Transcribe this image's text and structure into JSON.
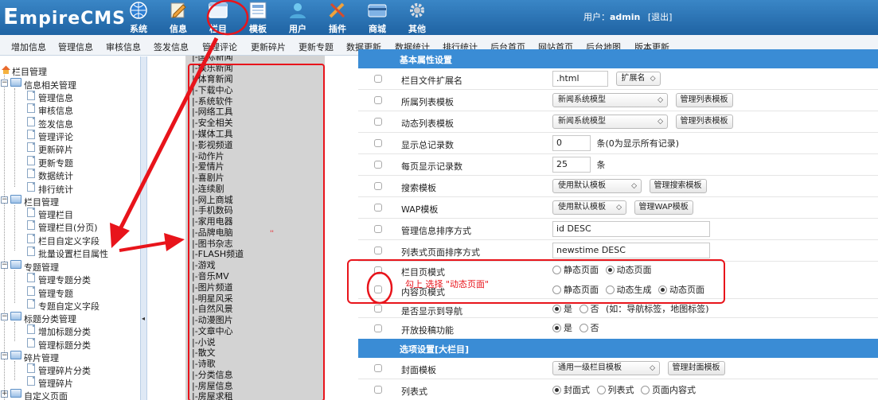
{
  "brand": {
    "logo_prefix": "E",
    "logo_rest": "mpireCMS"
  },
  "modules": [
    {
      "label": "系统",
      "icon": "globe-icon"
    },
    {
      "label": "信息",
      "icon": "pencil-icon"
    },
    {
      "label": "栏目",
      "icon": "window-icon"
    },
    {
      "label": "模板",
      "icon": "template-icon"
    },
    {
      "label": "用户",
      "icon": "user-icon"
    },
    {
      "label": "插件",
      "icon": "tools-icon"
    },
    {
      "label": "商城",
      "icon": "card-icon"
    },
    {
      "label": "其他",
      "icon": "gear-icon"
    }
  ],
  "user": {
    "prefix": "用户：",
    "name": "admin",
    "logout": "[退出]"
  },
  "nav": [
    "增加信息",
    "管理信息",
    "审核信息",
    "签发信息",
    "管理评论",
    "更新碎片",
    "更新专题",
    "数据更新",
    "数据统计",
    "排行统计",
    "后台首页",
    "网站首页",
    "后台地图",
    "版本更新"
  ],
  "tree": {
    "root": "栏目管理",
    "groups": [
      {
        "label": "信息相关管理",
        "items": [
          "管理信息",
          "审核信息",
          "签发信息",
          "管理评论",
          "更新碎片",
          "更新专题",
          "数据统计",
          "排行统计"
        ]
      },
      {
        "label": "栏目管理",
        "items": [
          "管理栏目",
          "管理栏目(分页)",
          "栏目自定义字段",
          "批量设置栏目属性"
        ]
      },
      {
        "label": "专题管理",
        "items": [
          "管理专题分类",
          "管理专题",
          "专题自定义字段"
        ]
      },
      {
        "label": "标题分类管理",
        "items": [
          "增加标题分类",
          "管理标题分类"
        ]
      },
      {
        "label": "碎片管理",
        "items": [
          "管理碎片分类",
          "管理碎片"
        ]
      },
      {
        "label": "自定义页面",
        "items": []
      }
    ]
  },
  "channels": [
    "|-国际新闻",
    "|-娱乐新闻",
    "|-体育新闻",
    "|-下载中心",
    "|-系统软件",
    "|-网络工具",
    "|-安全相关",
    "|-媒体工具",
    "|-影视频道",
    "|-动作片",
    "|-爱情片",
    "|-喜剧片",
    "|-连续剧",
    "|-网上商城",
    "|-手机数码",
    "|-家用电器",
    "|-品牌电脑",
    "|-图书杂志",
    "|-FLASH频道",
    "|-游戏",
    "|-音乐MV",
    "|-图片频道",
    "|-明星风采",
    "|-自然风景",
    "|-动漫图片",
    "|-文章中心",
    "|-小说",
    "|-散文",
    "|-诗歌",
    "|-分类信息",
    "|-房屋信息",
    "|-房屋求租"
  ],
  "form": {
    "section1": "基本属性设置",
    "section2": "选项设置[大栏目]",
    "rows": {
      "ext": {
        "label": "栏目文件扩展名",
        "value": ".html",
        "select": "扩展名"
      },
      "listtpl": {
        "label": "所属列表模板",
        "select": "新闻系统模型",
        "button": "管理列表模板"
      },
      "dyntpl": {
        "label": "动态列表模板",
        "select": "新闻系统模型",
        "button": "管理列表模板"
      },
      "total": {
        "label": "显示总记录数",
        "value": "0",
        "suffix": "条(0为显示所有记录)"
      },
      "perpage": {
        "label": "每页显示记录数",
        "value": "25",
        "suffix": "条"
      },
      "search": {
        "label": "搜索模板",
        "select": "使用默认模板",
        "button": "管理搜索模板"
      },
      "wap": {
        "label": "WAP模板",
        "select": "使用默认模板",
        "button": "管理WAP模板"
      },
      "sort": {
        "label": "管理信息排序方式",
        "value": "id DESC"
      },
      "listsort": {
        "label": "列表式页面排序方式",
        "value": "newstime DESC"
      },
      "chmode": {
        "label": "栏目页模式",
        "options": [
          "静态页面",
          "动态页面"
        ],
        "selected": "动态页面"
      },
      "ctmode": {
        "label": "内容页模式",
        "options": [
          "静态页面",
          "动态生成",
          "动态页面"
        ],
        "selected": "动态页面"
      },
      "showinnav": {
        "label": "是否显示到导航",
        "options": [
          "是",
          "否"
        ],
        "selected": "是",
        "note": "(如：导航标签，地图标签)"
      },
      "contribute": {
        "label": "开放投稿功能",
        "options": [
          "是",
          "否"
        ],
        "selected": "是"
      },
      "cover": {
        "label": "封面模板",
        "select": "通用一级栏目模板",
        "button": "管理封面模板"
      },
      "listmode": {
        "label": "列表式",
        "options": [
          "封面式",
          "列表式",
          "页面内容式"
        ],
        "selected": "封面式"
      }
    }
  },
  "annotation": {
    "text": "勾上 选择 \"动态页面\"",
    "color": "#e8141b"
  }
}
